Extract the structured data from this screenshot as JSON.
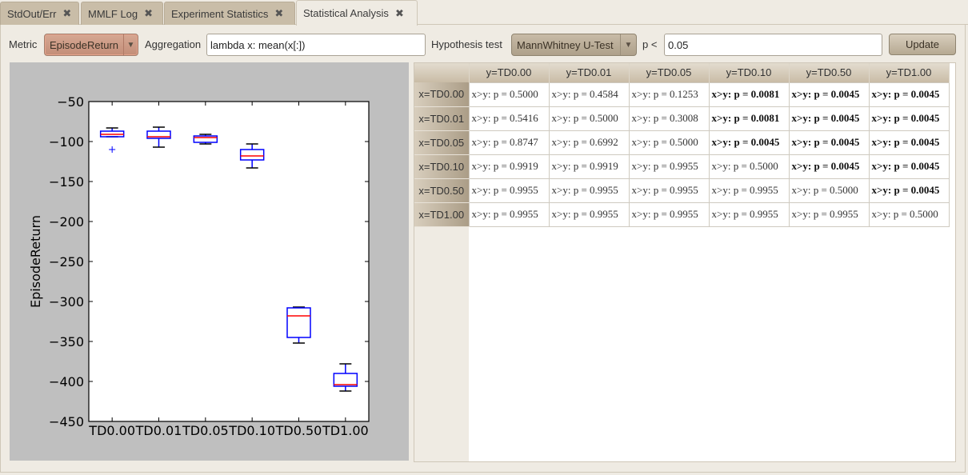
{
  "tabs": [
    {
      "label": "StdOut/Err",
      "active": false
    },
    {
      "label": "MMLF Log",
      "active": false
    },
    {
      "label": "Experiment Statistics",
      "active": false
    },
    {
      "label": "Statistical Analysis",
      "active": true
    }
  ],
  "close_glyph": "✖",
  "toolbar": {
    "metric_label": "Metric",
    "metric_value": "EpisodeReturn",
    "aggregation_label": "Aggregation",
    "aggregation_value": "lambda x: mean(x[:])",
    "test_label": "Hypothesis test",
    "test_value": "MannWhitney U-Test",
    "p_label": "p <",
    "p_value": "0.05",
    "update_label": "Update",
    "dropdown_arrow": "▼"
  },
  "colors": {
    "box": "#0000ff",
    "median": "#ff0000",
    "whisker_cap": "#000000",
    "plot_bg": "#ffffff",
    "figure_bg": "#bfbfbf"
  },
  "chart_data": {
    "type": "boxplot",
    "title": "",
    "xlabel": "",
    "ylabel": "EpisodeReturn",
    "ylim": [
      -450,
      -50
    ],
    "yticks": [
      -50,
      -100,
      -150,
      -200,
      -250,
      -300,
      -350,
      -400,
      -450
    ],
    "categories": [
      "TD0.00",
      "TD0.01",
      "TD0.05",
      "TD0.10",
      "TD0.50",
      "TD1.00"
    ],
    "boxes": [
      {
        "name": "TD0.00",
        "whisker_high": -83,
        "q3": -87,
        "median": -91,
        "q1": -94,
        "whisker_low": -94,
        "outliers": [
          -110
        ]
      },
      {
        "name": "TD0.01",
        "whisker_high": -82,
        "q3": -87,
        "median": -94,
        "q1": -96,
        "whisker_low": -107,
        "outliers": []
      },
      {
        "name": "TD0.05",
        "whisker_high": -91,
        "q3": -93,
        "median": -95,
        "q1": -101,
        "whisker_low": -103,
        "outliers": []
      },
      {
        "name": "TD0.10",
        "whisker_high": -103,
        "q3": -110,
        "median": -118,
        "q1": -123,
        "whisker_low": -133,
        "outliers": []
      },
      {
        "name": "TD0.50",
        "whisker_high": -307,
        "q3": -308,
        "median": -318,
        "q1": -345,
        "whisker_low": -352,
        "outliers": []
      },
      {
        "name": "TD1.00",
        "whisker_high": -378,
        "q3": -390,
        "median": -404,
        "q1": -406,
        "whisker_low": -412,
        "outliers": []
      }
    ],
    "grid": false
  },
  "table": {
    "columns": [
      "y=TD0.00",
      "y=TD0.01",
      "y=TD0.05",
      "y=TD0.10",
      "y=TD0.50",
      "y=TD1.00"
    ],
    "rows": [
      {
        "header": "x=TD0.00",
        "cells": [
          {
            "text": "x>y: p = 0.5000",
            "significant": false
          },
          {
            "text": "x>y: p = 0.4584",
            "significant": false
          },
          {
            "text": "x>y: p = 0.1253",
            "significant": false
          },
          {
            "text": "x>y: p = 0.0081",
            "significant": true
          },
          {
            "text": "x>y: p = 0.0045",
            "significant": true
          },
          {
            "text": "x>y: p = 0.0045",
            "significant": true
          }
        ]
      },
      {
        "header": "x=TD0.01",
        "cells": [
          {
            "text": "x>y: p = 0.5416",
            "significant": false
          },
          {
            "text": "x>y: p = 0.5000",
            "significant": false
          },
          {
            "text": "x>y: p = 0.3008",
            "significant": false
          },
          {
            "text": "x>y: p = 0.0081",
            "significant": true
          },
          {
            "text": "x>y: p = 0.0045",
            "significant": true
          },
          {
            "text": "x>y: p = 0.0045",
            "significant": true
          }
        ]
      },
      {
        "header": "x=TD0.05",
        "cells": [
          {
            "text": "x>y: p = 0.8747",
            "significant": false
          },
          {
            "text": "x>y: p = 0.6992",
            "significant": false
          },
          {
            "text": "x>y: p = 0.5000",
            "significant": false
          },
          {
            "text": "x>y: p = 0.0045",
            "significant": true
          },
          {
            "text": "x>y: p = 0.0045",
            "significant": true
          },
          {
            "text": "x>y: p = 0.0045",
            "significant": true
          }
        ]
      },
      {
        "header": "x=TD0.10",
        "cells": [
          {
            "text": "x>y: p = 0.9919",
            "significant": false
          },
          {
            "text": "x>y: p = 0.9919",
            "significant": false
          },
          {
            "text": "x>y: p = 0.9955",
            "significant": false
          },
          {
            "text": "x>y: p = 0.5000",
            "significant": false
          },
          {
            "text": "x>y: p = 0.0045",
            "significant": true
          },
          {
            "text": "x>y: p = 0.0045",
            "significant": true
          }
        ]
      },
      {
        "header": "x=TD0.50",
        "cells": [
          {
            "text": "x>y: p = 0.9955",
            "significant": false
          },
          {
            "text": "x>y: p = 0.9955",
            "significant": false
          },
          {
            "text": "x>y: p = 0.9955",
            "significant": false
          },
          {
            "text": "x>y: p = 0.9955",
            "significant": false
          },
          {
            "text": "x>y: p = 0.5000",
            "significant": false
          },
          {
            "text": "x>y: p = 0.0045",
            "significant": true
          }
        ]
      },
      {
        "header": "x=TD1.00",
        "cells": [
          {
            "text": "x>y: p = 0.9955",
            "significant": false
          },
          {
            "text": "x>y: p = 0.9955",
            "significant": false
          },
          {
            "text": "x>y: p = 0.9955",
            "significant": false
          },
          {
            "text": "x>y: p = 0.9955",
            "significant": false
          },
          {
            "text": "x>y: p = 0.9955",
            "significant": false
          },
          {
            "text": "x>y: p = 0.5000",
            "significant": false
          }
        ]
      }
    ]
  }
}
